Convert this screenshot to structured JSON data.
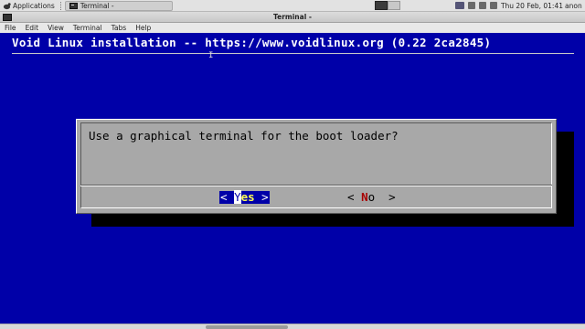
{
  "panel": {
    "applications_label": "Applications",
    "task_label": "Terminal -",
    "clock": "Thu 20 Feb, 01:41",
    "user": "anon"
  },
  "window": {
    "title": "Terminal -"
  },
  "menubar": {
    "items": [
      "File",
      "Edit",
      "View",
      "Terminal",
      "Tabs",
      "Help"
    ]
  },
  "terminal": {
    "heading": "Void Linux installation -- https://www.voidlinux.org (0.22 2ca2845)",
    "dialog": {
      "question": "Use a graphical terminal for the boot loader?",
      "yes_button": {
        "prefix": "< ",
        "hotkey": "Y",
        "rest": "es",
        "suffix": " >"
      },
      "no_button": {
        "prefix": "< ",
        "hotkey": "N",
        "rest": "o",
        "suffix": "  >"
      }
    }
  },
  "colors": {
    "terminal_background": "#0000a8",
    "dialog_background": "#a8a8a8",
    "selected_button": "#0000a8",
    "hotkey_red": "#a80000"
  }
}
